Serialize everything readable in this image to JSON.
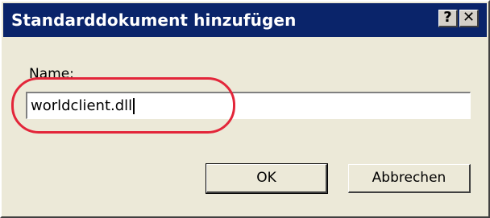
{
  "dialog": {
    "title": "Standarddokument hinzufügen",
    "help_glyph": "?",
    "close_glyph": "✕",
    "name_label_first": "N",
    "name_label_rest": "ame:",
    "name_value": "worldclient.dll",
    "ok_label": "OK",
    "cancel_label": "Abbrechen"
  },
  "annotation": {
    "highlight_color": "#e3263a"
  }
}
